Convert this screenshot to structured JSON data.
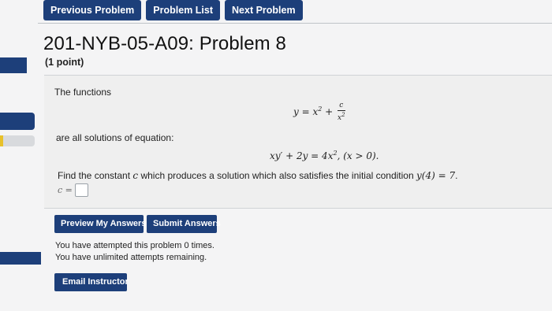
{
  "nav": {
    "previous_label": "Previous Problem",
    "list_label": "Problem List",
    "next_label": "Next Problem"
  },
  "problem": {
    "title": "201-NYB-05-A09: Problem 8",
    "points": "(1 point)",
    "intro": "The functions",
    "equation_intro": "are all solutions of equation:",
    "eq1": {
      "lhs": "y = x",
      "exp": "2",
      "plus": " + ",
      "frac_num": "c",
      "frac_den_base": "x",
      "frac_den_exp": "2"
    },
    "eq2": {
      "part_a": "xy′ + 2y = 4x",
      "exp": "2",
      "part_b": ", (x > 0)."
    },
    "question_start": "Find the constant ",
    "question_var": "c",
    "question_mid": " which produces a solution which also satisfies the initial condition ",
    "question_cond": "y(4) = 7",
    "question_end": "."
  },
  "answer": {
    "label": "c =",
    "value": ""
  },
  "actions": {
    "preview_label": "Preview My Answers",
    "submit_label": "Submit Answers"
  },
  "status": {
    "attempts_made": "You have attempted this problem 0 times.",
    "attempts_left": "You have unlimited attempts remaining."
  },
  "email_label": "Email Instructor",
  "colors": {
    "button": "#1d3f7a",
    "sidebar_accent": "#e8c12a"
  }
}
